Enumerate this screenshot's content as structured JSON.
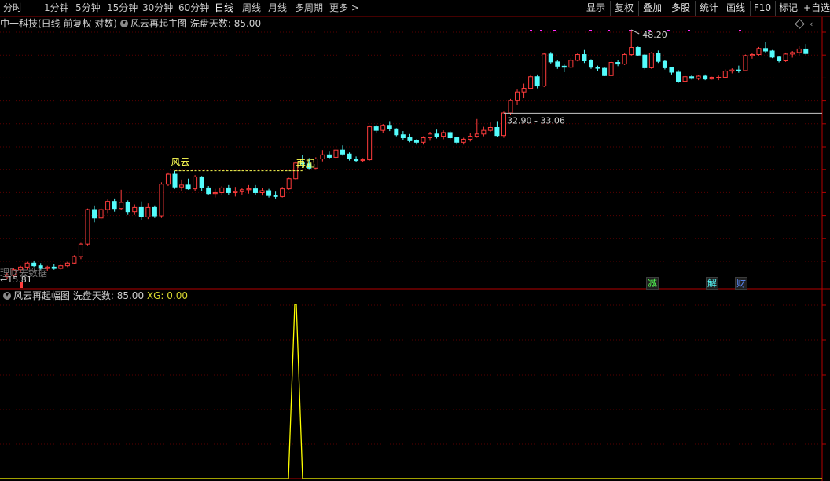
{
  "toolbar": {
    "periods": [
      "分时",
      "1分钟",
      "5分钟",
      "15分钟",
      "30分钟",
      "60分钟",
      "日线",
      "周线",
      "月线",
      "多周期",
      "更多 >"
    ],
    "active_period": "日线",
    "buttons": [
      "显示",
      "复权",
      "叠加",
      "多股",
      "统计",
      "画线",
      "F10",
      "标记",
      "+自选"
    ]
  },
  "main_chart": {
    "security": "中一科技(日线 前复权 对数)",
    "indicator_name": "风云再起主图",
    "param_label": "洗盘天数:",
    "param_value": "85.00",
    "high_label": "48.20",
    "low_label": "15.81",
    "range_label": "32.90 - 33.06",
    "signal_fengyun": "风云",
    "signal_zaiqi": "再起",
    "overlay_text": "理财去数据",
    "badges": [
      "减",
      "解",
      "财"
    ],
    "colors": {
      "up": "#ff3c3c",
      "down": "#54fcfc",
      "grid": "#5a0000",
      "signal": "#ffff54",
      "dot": "#ff28ff"
    }
  },
  "sub_chart": {
    "indicator_name": "风云再起幅图",
    "param_label": "洗盘天数:",
    "param_value": "85.00",
    "xg_label": "XG:",
    "xg_value": "0.00"
  },
  "chart_data": {
    "type": "candlestick",
    "series": [
      {
        "name": "K线",
        "ohlc": [
          [
            15.8,
            16.1,
            15.6,
            15.9
          ],
          [
            15.9,
            16.4,
            15.8,
            16.3
          ],
          [
            16.3,
            16.6,
            16.1,
            16.5
          ],
          [
            16.5,
            16.9,
            16.3,
            16.8
          ],
          [
            16.8,
            17.0,
            16.5,
            16.6
          ],
          [
            16.6,
            16.8,
            16.3,
            16.4
          ],
          [
            16.4,
            16.6,
            16.2,
            16.5
          ],
          [
            16.5,
            16.7,
            16.3,
            16.4
          ],
          [
            16.4,
            16.7,
            16.3,
            16.6
          ],
          [
            16.6,
            16.9,
            16.5,
            16.8
          ],
          [
            16.8,
            17.4,
            16.7,
            17.3
          ],
          [
            17.3,
            18.4,
            17.1,
            18.3
          ],
          [
            18.3,
            21.5,
            18.2,
            21.4
          ],
          [
            21.4,
            21.8,
            20.2,
            20.6
          ],
          [
            20.6,
            21.6,
            20.4,
            21.4
          ],
          [
            21.4,
            22.4,
            21.0,
            22.2
          ],
          [
            22.2,
            22.5,
            21.2,
            21.5
          ],
          [
            21.5,
            23.4,
            21.4,
            22.1
          ],
          [
            22.1,
            22.3,
            20.9,
            21.2
          ],
          [
            21.2,
            21.9,
            20.9,
            21.6
          ],
          [
            21.6,
            22.2,
            20.4,
            20.7
          ],
          [
            20.7,
            22.0,
            20.5,
            21.6
          ],
          [
            21.6,
            21.8,
            20.6,
            20.8
          ],
          [
            20.8,
            24.2,
            20.6,
            24.0
          ],
          [
            24.0,
            25.3,
            23.8,
            25.1
          ],
          [
            25.1,
            25.5,
            23.5,
            23.7
          ],
          [
            23.7,
            24.5,
            23.3,
            23.9
          ],
          [
            23.9,
            24.6,
            23.4,
            23.5
          ],
          [
            23.5,
            25.0,
            23.3,
            24.8
          ],
          [
            24.8,
            24.9,
            23.3,
            23.6
          ],
          [
            23.6,
            23.8,
            22.9,
            23.0
          ],
          [
            23.0,
            23.5,
            22.6,
            23.1
          ],
          [
            23.1,
            23.8,
            22.8,
            23.6
          ],
          [
            23.6,
            23.9,
            22.9,
            23.1
          ],
          [
            23.1,
            23.7,
            22.7,
            23.2
          ],
          [
            23.2,
            23.6,
            22.9,
            23.4
          ],
          [
            23.4,
            23.9,
            23.0,
            23.5
          ],
          [
            23.5,
            23.9,
            22.9,
            23.1
          ],
          [
            23.1,
            23.6,
            22.8,
            23.3
          ],
          [
            23.3,
            23.5,
            22.6,
            22.8
          ],
          [
            22.8,
            23.2,
            22.5,
            22.7
          ],
          [
            22.7,
            23.7,
            22.6,
            23.5
          ],
          [
            23.5,
            24.7,
            23.4,
            24.6
          ],
          [
            24.6,
            26.6,
            24.5,
            26.4
          ],
          [
            26.4,
            27.4,
            25.9,
            26.3
          ],
          [
            26.3,
            27.0,
            25.6,
            25.8
          ],
          [
            25.8,
            27.1,
            25.6,
            26.9
          ],
          [
            26.9,
            28.0,
            26.6,
            27.4
          ],
          [
            27.4,
            27.8,
            26.9,
            27.1
          ],
          [
            27.1,
            28.1,
            26.9,
            28.0
          ],
          [
            28.0,
            28.6,
            27.3,
            27.5
          ],
          [
            27.5,
            27.7,
            26.7,
            26.9
          ],
          [
            26.9,
            27.2,
            26.5,
            26.7
          ],
          [
            26.7,
            27.0,
            26.5,
            26.8
          ],
          [
            26.8,
            31.3,
            26.7,
            31.1
          ],
          [
            31.1,
            31.4,
            30.3,
            30.6
          ],
          [
            30.6,
            31.5,
            30.2,
            31.3
          ],
          [
            31.3,
            31.9,
            30.5,
            30.8
          ],
          [
            30.8,
            30.9,
            29.8,
            30.0
          ],
          [
            30.0,
            30.5,
            29.3,
            29.6
          ],
          [
            29.6,
            30.1,
            29.0,
            29.2
          ],
          [
            29.2,
            29.4,
            28.7,
            29.0
          ],
          [
            29.0,
            29.8,
            28.7,
            29.6
          ],
          [
            29.6,
            30.4,
            29.2,
            30.1
          ],
          [
            30.1,
            30.7,
            29.5,
            29.8
          ],
          [
            29.8,
            30.6,
            29.4,
            30.3
          ],
          [
            30.3,
            30.5,
            29.4,
            29.6
          ],
          [
            29.6,
            29.7,
            28.7,
            29.0
          ],
          [
            29.0,
            29.6,
            28.7,
            29.4
          ],
          [
            29.4,
            30.2,
            29.1,
            29.8
          ],
          [
            29.8,
            32.2,
            29.6,
            30.1
          ],
          [
            30.1,
            31.1,
            29.8,
            30.6
          ],
          [
            30.6,
            31.8,
            30.4,
            31.0
          ],
          [
            31.0,
            31.9,
            29.7,
            29.9
          ],
          [
            29.9,
            33.3,
            29.6,
            33.1
          ],
          [
            33.1,
            35.3,
            32.8,
            35.0
          ],
          [
            35.0,
            36.8,
            34.3,
            36.4
          ],
          [
            36.4,
            37.8,
            35.4,
            37.0
          ],
          [
            37.0,
            39.4,
            36.8,
            39.0
          ],
          [
            39.0,
            39.4,
            37.0,
            37.4
          ],
          [
            37.4,
            43.5,
            37.2,
            43.2
          ],
          [
            43.2,
            43.6,
            41.4,
            41.7
          ],
          [
            41.7,
            42.0,
            40.4,
            40.9
          ],
          [
            40.9,
            41.2,
            39.8,
            40.7
          ],
          [
            40.7,
            42.4,
            40.5,
            42.0
          ],
          [
            42.0,
            43.4,
            41.8,
            43.1
          ],
          [
            43.1,
            44.0,
            41.5,
            41.9
          ],
          [
            41.9,
            42.2,
            40.4,
            40.7
          ],
          [
            40.7,
            41.0,
            40.0,
            40.5
          ],
          [
            40.5,
            40.8,
            39.1,
            39.2
          ],
          [
            39.2,
            41.9,
            39.1,
            41.6
          ],
          [
            41.6,
            42.1,
            40.9,
            41.3
          ],
          [
            41.3,
            43.5,
            41.1,
            43.1
          ],
          [
            43.1,
            48.2,
            42.8,
            44.5
          ],
          [
            44.5,
            44.7,
            42.8,
            43.0
          ],
          [
            43.0,
            43.2,
            40.3,
            40.6
          ],
          [
            40.6,
            43.6,
            40.4,
            43.4
          ],
          [
            43.4,
            43.9,
            41.5,
            41.8
          ],
          [
            41.8,
            42.0,
            40.3,
            40.6
          ],
          [
            40.6,
            40.8,
            39.4,
            39.8
          ],
          [
            39.8,
            40.2,
            37.9,
            38.2
          ],
          [
            38.2,
            39.4,
            38.0,
            39.0
          ],
          [
            39.0,
            39.3,
            38.5,
            38.7
          ],
          [
            38.7,
            39.3,
            38.4,
            39.1
          ],
          [
            39.1,
            39.4,
            38.4,
            38.6
          ],
          [
            38.6,
            39.0,
            38.5,
            38.9
          ],
          [
            38.9,
            39.2,
            38.4,
            38.9
          ],
          [
            38.9,
            40.3,
            38.7,
            40.0
          ],
          [
            40.0,
            40.5,
            39.6,
            40.2
          ],
          [
            40.2,
            41.0,
            39.7,
            40.1
          ],
          [
            40.1,
            43.1,
            40.0,
            42.9
          ],
          [
            42.9,
            43.4,
            42.3,
            43.1
          ],
          [
            43.1,
            44.6,
            42.9,
            44.3
          ],
          [
            44.3,
            45.6,
            43.5,
            43.8
          ],
          [
            43.8,
            44.0,
            42.4,
            42.6
          ],
          [
            42.6,
            42.8,
            41.6,
            41.9
          ],
          [
            41.9,
            43.5,
            41.7,
            43.2
          ],
          [
            43.2,
            43.8,
            42.5,
            43.5
          ],
          [
            43.5,
            44.9,
            42.8,
            44.2
          ],
          [
            44.2,
            45.2,
            43.1,
            43.3
          ]
        ]
      }
    ],
    "levels": {
      "high": 48.2,
      "low": 15.81,
      "range": [
        32.9,
        33.06
      ]
    },
    "sub_series": [
      {
        "name": "XG",
        "values_at_signal": [
          [
            42,
            1
          ]
        ]
      }
    ]
  }
}
